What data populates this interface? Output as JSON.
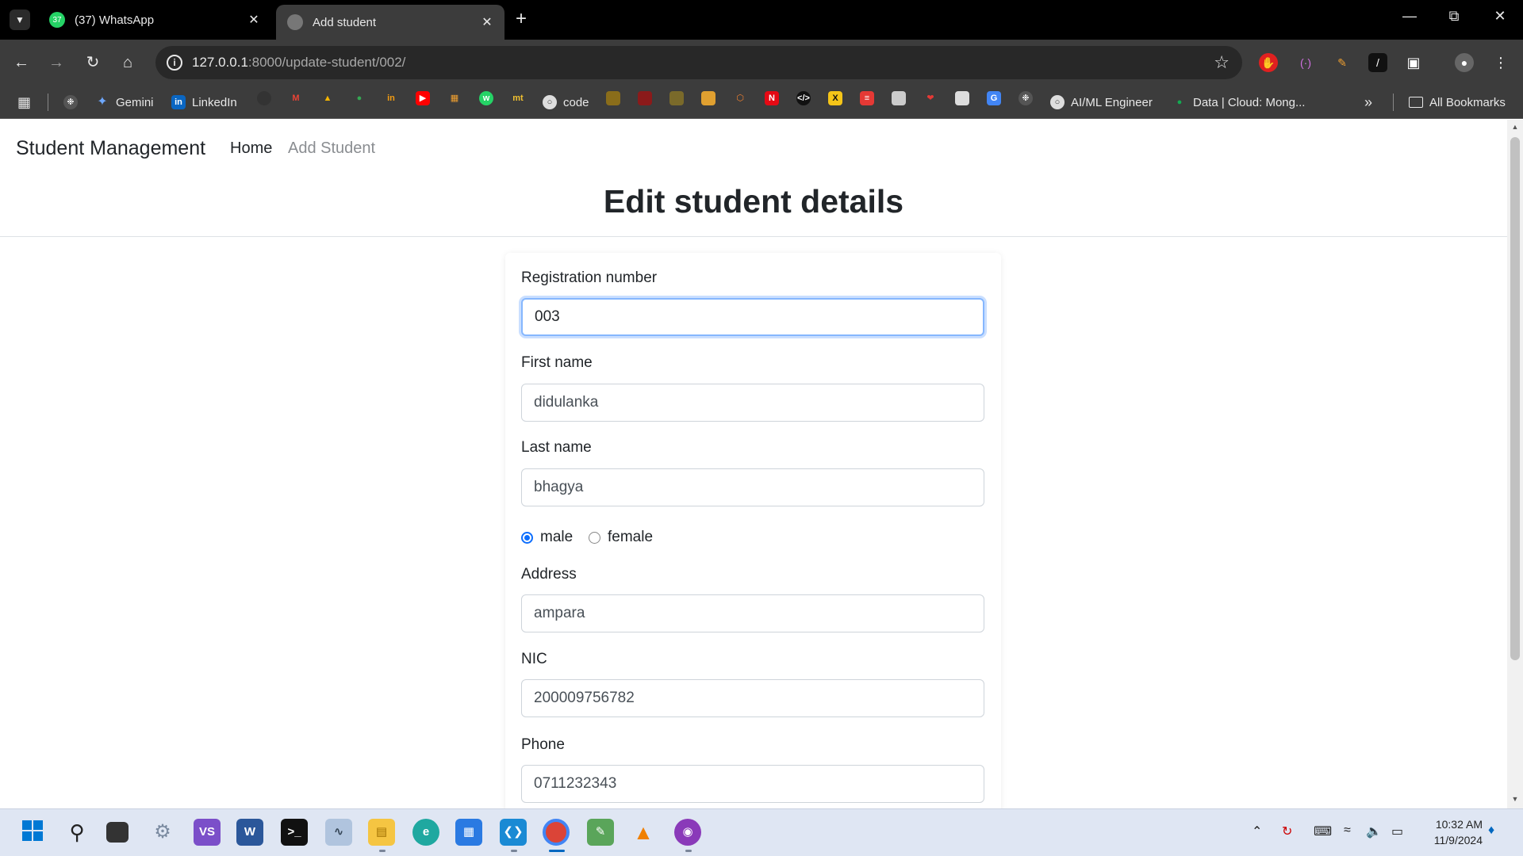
{
  "browser": {
    "tabs": [
      {
        "title": "(37) WhatsApp",
        "active": false,
        "favicon": "whatsapp-icon"
      },
      {
        "title": "Add student",
        "active": true,
        "favicon": "globe-icon"
      }
    ],
    "url_host": "127.0.0.1",
    "url_rest": ":8000/update-student/002/",
    "bookmarks": {
      "gemini": "Gemini",
      "linkedin": "LinkedIn",
      "code": "code",
      "aiml": "AI/ML Engineer",
      "mongo": "Data | Cloud: Mong...",
      "all": "All Bookmarks"
    }
  },
  "page": {
    "brand": "Student Management",
    "nav": {
      "home": "Home",
      "add": "Add Student"
    },
    "heading": "Edit student details",
    "form": {
      "registration_label": "Registration number",
      "registration_value": "003",
      "first_name_label": "First name",
      "first_name_value": "didulanka",
      "last_name_label": "Last name",
      "last_name_value": "bhagya",
      "gender_male": "male",
      "gender_female": "female",
      "address_label": "Address",
      "address_value": "ampara",
      "nic_label": "NIC",
      "nic_value": "200009756782",
      "phone_label": "Phone",
      "phone_value": "0711232343"
    }
  },
  "taskbar": {
    "time": "10:32 AM",
    "date": "11/9/2024"
  },
  "colors": {
    "accent": "#0d6efd",
    "chrome_dark": "#3c3c3c",
    "taskbar": "#dfe6f3"
  }
}
